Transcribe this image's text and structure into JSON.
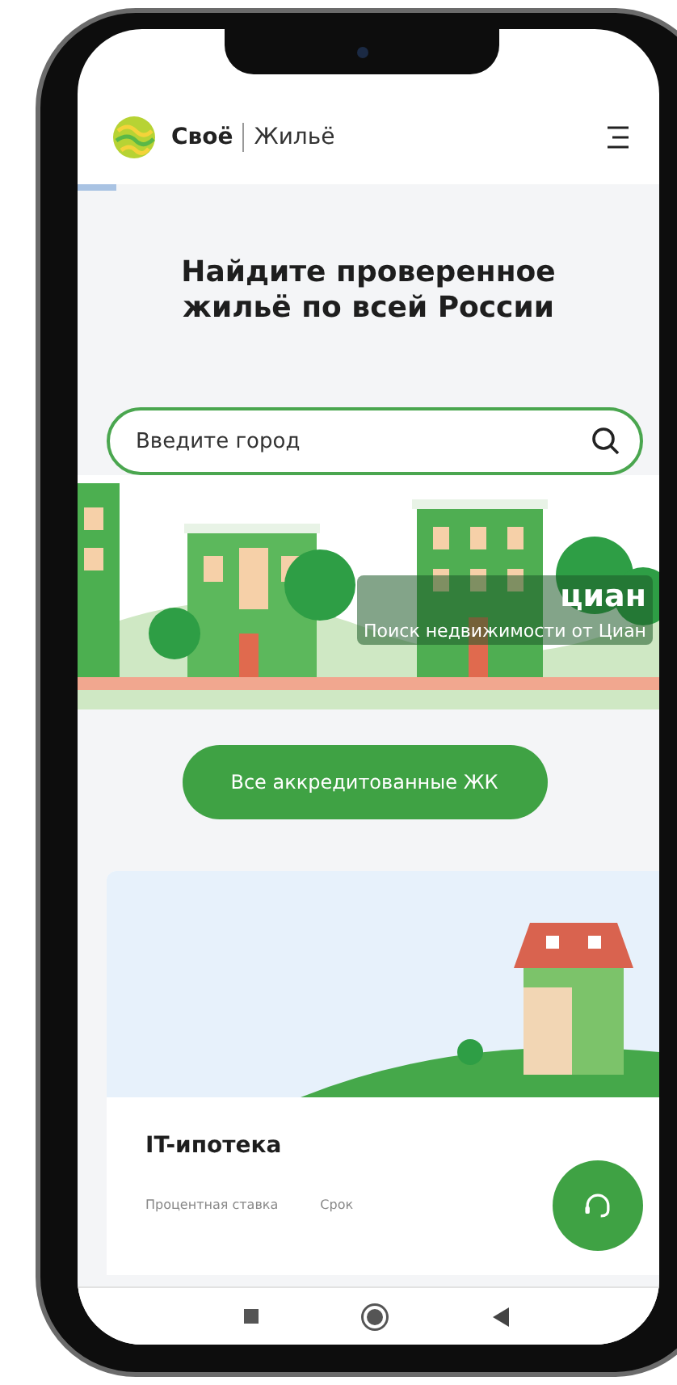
{
  "header": {
    "brand_first": "Своё",
    "brand_second": "Жильё"
  },
  "hero": {
    "title": "Найдите проверенное жильё по всей России"
  },
  "search": {
    "placeholder": "Введите город"
  },
  "banner": {
    "brand": "циан",
    "caption": "Поиск недвижимости от Циан"
  },
  "button": {
    "label": "Все аккредитованные ЖК"
  },
  "card": {
    "title": "IT-ипотека",
    "stats": [
      {
        "label": "Процентная ставка"
      },
      {
        "label": "Срок"
      }
    ]
  }
}
